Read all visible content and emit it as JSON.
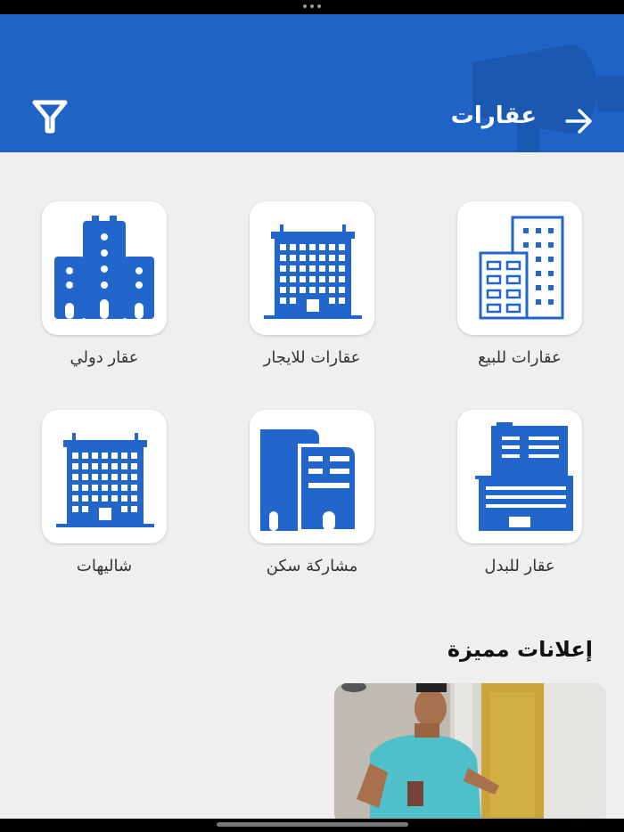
{
  "header": {
    "title": "عقارات",
    "back_icon": "arrow-right-icon",
    "filter_icon": "filter-icon"
  },
  "categories": [
    {
      "label": "عقارات للبيع",
      "icon": "office-buildings-icon"
    },
    {
      "label": "عقارات للايجار",
      "icon": "apartment-block-icon"
    },
    {
      "label": "عقار دولي",
      "icon": "towers-icon"
    },
    {
      "label": "عقار للبدل",
      "icon": "corporate-building-icon"
    },
    {
      "label": "مشاركة سكن",
      "icon": "shared-building-icon"
    },
    {
      "label": "شاليهات",
      "icon": "chalet-building-icon"
    }
  ],
  "featured": {
    "title": "إعلانات مميزة"
  },
  "colors": {
    "brand": "#1f63c6",
    "background": "#efefef"
  }
}
